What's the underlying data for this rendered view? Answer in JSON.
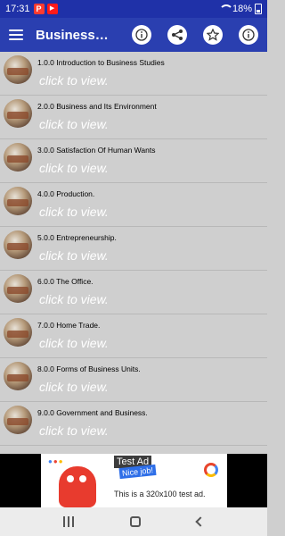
{
  "status_bar": {
    "time": "17:31",
    "battery": "18%",
    "icons": [
      "p-app-icon",
      "youtube-icon",
      "wifi-icon",
      "battery-icon"
    ]
  },
  "app_bar": {
    "title": "Business…",
    "icons": [
      "menu-icon",
      "info-icon",
      "share-icon",
      "star-icon",
      "info-icon"
    ],
    "color": "#2a3fb0"
  },
  "list": {
    "items": [
      {
        "title": "1.0.0 Introduction to Business Studies",
        "subtitle": "click to view."
      },
      {
        "title": "2.0.0 Business and Its Environment",
        "subtitle": "click to view."
      },
      {
        "title": "3.0.0 Satisfaction Of Human Wants",
        "subtitle": "click to view."
      },
      {
        "title": "4.0.0 Production.",
        "subtitle": "click to view."
      },
      {
        "title": "5.0.0 Entrepreneurship.",
        "subtitle": "click to view."
      },
      {
        "title": "6.0.0 The Office.",
        "subtitle": "click to view."
      },
      {
        "title": "7.0.0 Home Trade.",
        "subtitle": "click to view."
      },
      {
        "title": "8.0.0 Forms of Business Units.",
        "subtitle": "click to view."
      },
      {
        "title": "9.0.0 Government and  Business.",
        "subtitle": "click to view."
      }
    ]
  },
  "ad": {
    "badge": "Test Ad",
    "tagline": "Nice job!",
    "text": "This is a 320x100 test ad."
  }
}
